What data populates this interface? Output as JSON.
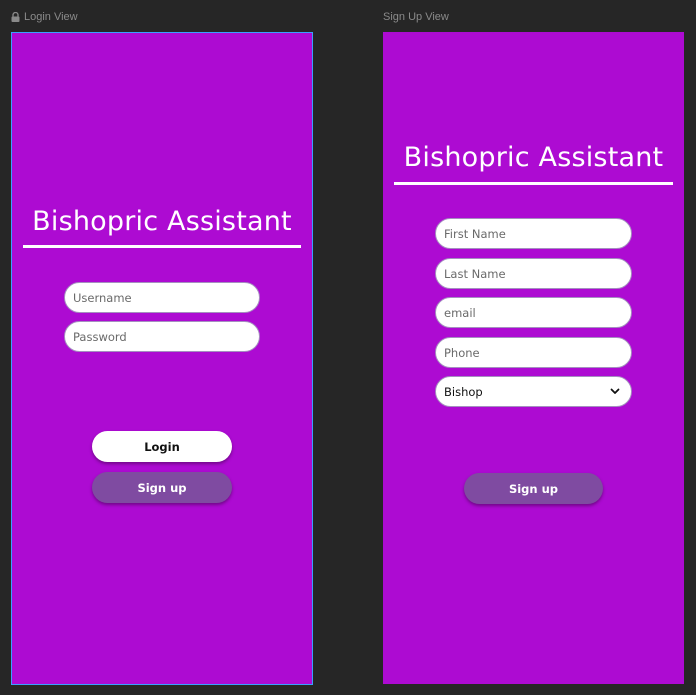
{
  "login": {
    "frame_label": "Login View",
    "title": "Bishopric Assistant",
    "username_placeholder": "Username",
    "password_placeholder": "Password",
    "login_button": "Login",
    "signup_button": "Sign up"
  },
  "signup": {
    "frame_label": "Sign Up View",
    "title": "Bishopric Assistant",
    "first_name_placeholder": "First Name",
    "last_name_placeholder": "Last Name",
    "email_placeholder": "email",
    "phone_placeholder": "Phone",
    "role_select": "Bishop",
    "signup_button": "Sign up"
  },
  "colors": {
    "canvas": "#262626",
    "frame_bg": "#ad0bd2",
    "secondary_button": "#7f4ba1",
    "selection_border": "#3aa0ff"
  }
}
